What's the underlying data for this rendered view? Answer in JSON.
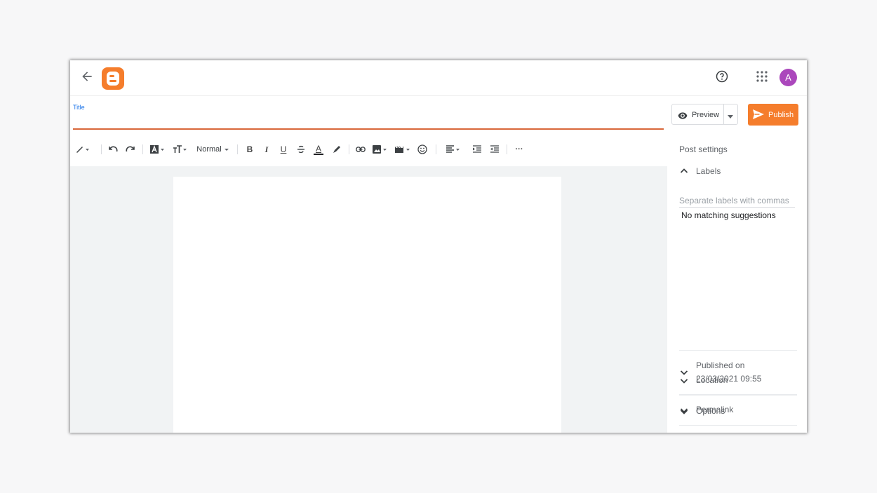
{
  "header": {
    "back_icon": "arrow-left-icon",
    "logo": "blogger-logo",
    "help_icon": "help-circle-icon",
    "apps_icon": "apps-grid-icon",
    "avatar_letter": "A",
    "avatar_color": "#ab47bc"
  },
  "editor": {
    "title_label": "Title",
    "title_value": "",
    "accent_color": "#f57d2c"
  },
  "actions": {
    "preview_label": "Preview",
    "publish_label": "Publish"
  },
  "toolbar": {
    "items": [
      "pencil-icon",
      "undo-icon",
      "redo-icon",
      "text-color-bg-icon",
      "font-size-icon",
      "paragraph-style",
      "bold-icon",
      "italic-icon",
      "underline-icon",
      "strikethrough-icon",
      "text-color-icon",
      "highlight-icon",
      "link-icon",
      "image-icon",
      "video-icon",
      "emoji-icon",
      "align-icon",
      "indent-icon",
      "outdent-icon",
      "more-icon"
    ],
    "paragraph_style": "Normal",
    "bold": "B",
    "italic": "I",
    "underline": "U",
    "text_color_letter": "A",
    "more": "···"
  },
  "settings": {
    "title": "Post settings",
    "labels": {
      "label": "Labels",
      "placeholder": "Separate labels with commas",
      "no_match": "No matching suggestions"
    },
    "published_label": "Published on",
    "published_date": "23/03/2021 09:55",
    "permalink_label": "Permalink",
    "location_label": "Location",
    "options_label": "Options"
  }
}
